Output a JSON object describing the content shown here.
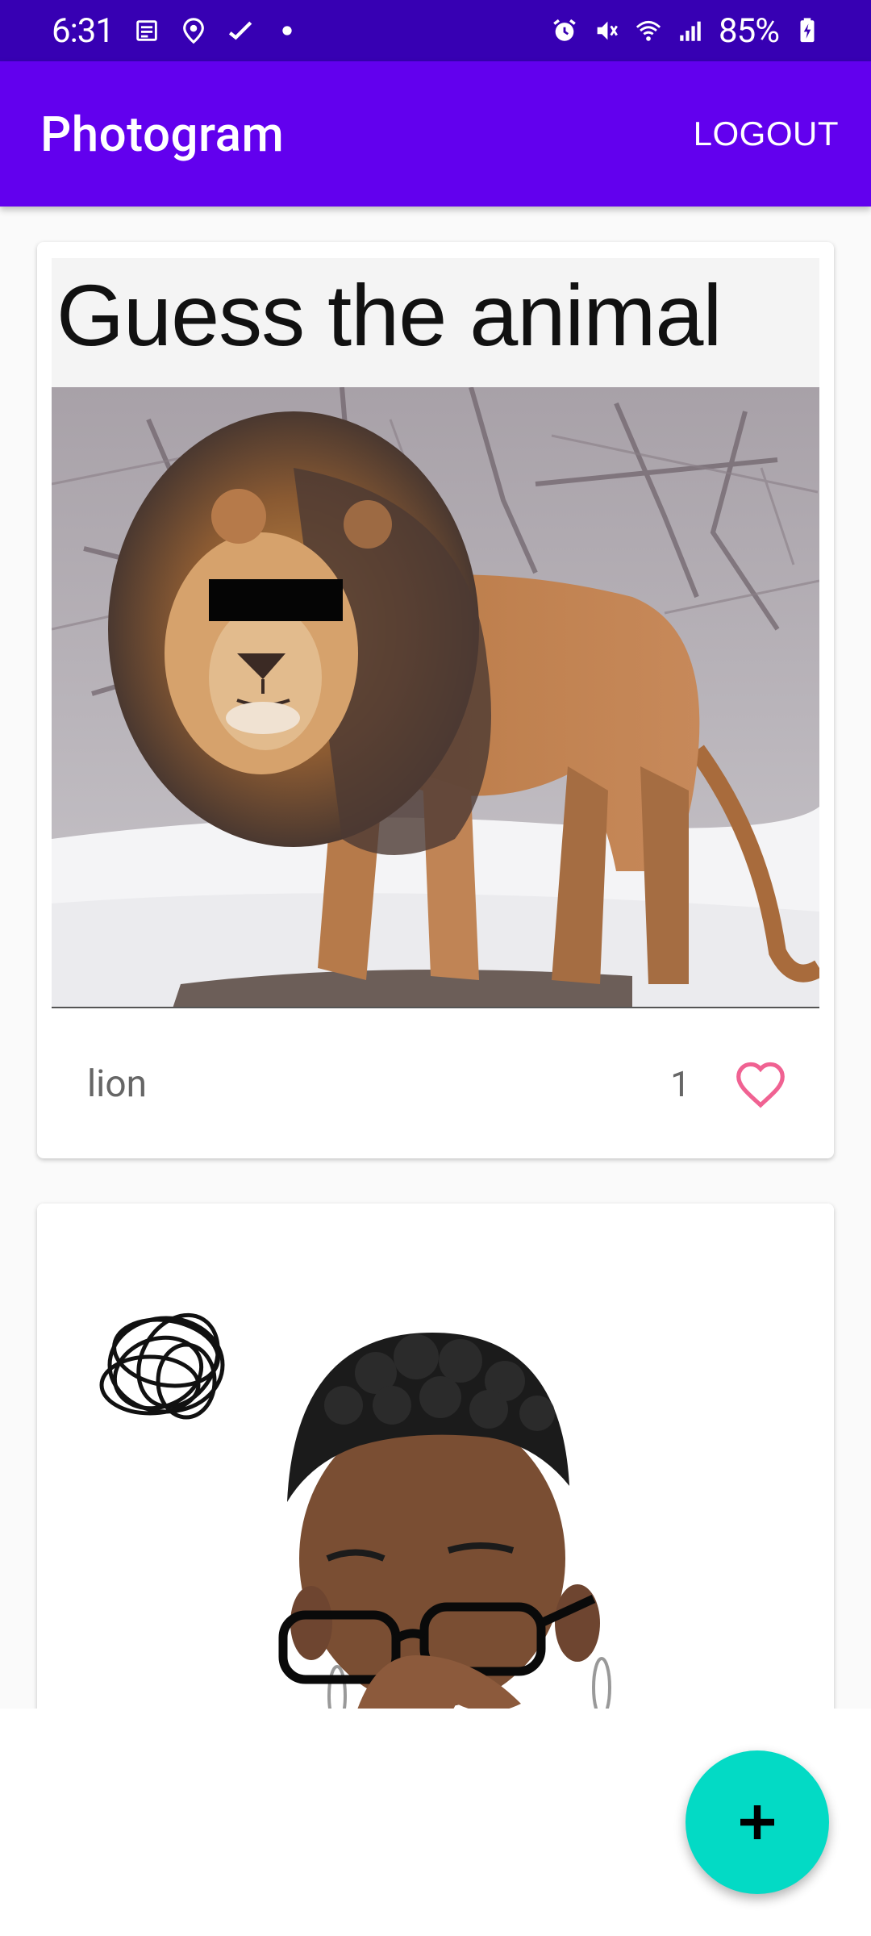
{
  "status_bar": {
    "time": "6:31",
    "battery": "85%",
    "background": "#3700b3"
  },
  "app_bar": {
    "title": "Photogram",
    "logout_label": "LOGOUT",
    "background": "#6200ee"
  },
  "posts": [
    {
      "meme_caption": "Guess the animal",
      "label": "lion",
      "likes": "1",
      "heart_color": "#f06292"
    },
    {}
  ],
  "fab": {
    "icon": "plus-icon",
    "color": "#03dac5"
  }
}
